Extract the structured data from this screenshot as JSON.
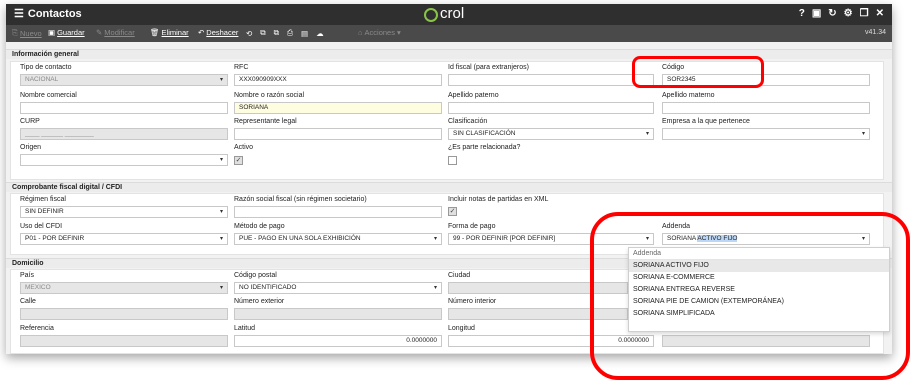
{
  "window": {
    "title": "Contactos",
    "brand": "crol",
    "version": "v41.34",
    "title_icons": [
      "help-icon",
      "chat-icon",
      "refresh-icon",
      "settings-icon",
      "restore-icon",
      "close-icon"
    ]
  },
  "toolbar": {
    "nuevo": "Nuevo",
    "guardar": "Guardar",
    "modificar": "Modificar",
    "eliminar": "Eliminar",
    "deshacer": "Deshacer",
    "acciones": "Acciones"
  },
  "general": {
    "section_title": "Información general",
    "tipo_contacto_label": "Tipo de contacto",
    "tipo_contacto_value": "NACIONAL",
    "rfc_label": "RFC",
    "rfc_value": "XXX090909XXX",
    "id_fiscal_label": "Id fiscal (para extranjeros)",
    "id_fiscal_value": "",
    "codigo_label": "Código",
    "codigo_value": "SOR2345",
    "nombre_comercial_label": "Nombre comercial",
    "nombre_comercial_value": "",
    "razon_social_label": "Nombre o razón social",
    "razon_social_value": "SORIANA",
    "apellido_paterno_label": "Apellido paterno",
    "apellido_paterno_value": "",
    "apellido_materno_label": "Apellido materno",
    "apellido_materno_value": "",
    "curp_label": "CURP",
    "curp_value": "____ ______ ________",
    "representante_label": "Representante legal",
    "representante_value": "",
    "clasificacion_label": "Clasificación",
    "clasificacion_value": "SIN CLASIFICACIÓN",
    "empresa_label": "Empresa a la que pertenece",
    "empresa_value": "",
    "origen_label": "Origen",
    "origen_value": "",
    "activo_label": "Activo",
    "parte_relacionada_label": "¿Es parte relacionada?"
  },
  "cfdi": {
    "section_title": "Comprobante fiscal digital / CFDI",
    "regimen_label": "Régimen fiscal",
    "regimen_value": "SIN DEFINIR",
    "razon_sin_regimen_label": "Razón social fiscal (sin régimen societario)",
    "razon_sin_regimen_value": "",
    "incluir_notas_label": "Incluir notas de partidas en XML",
    "uso_cfdi_label": "Uso del CFDI",
    "uso_cfdi_value": "P01 - POR DEFINIR",
    "metodo_pago_label": "Método de pago",
    "metodo_pago_value": "PUE - PAGO EN UNA SOLA EXHIBICIÓN",
    "forma_pago_label": "Forma de pago",
    "forma_pago_value": "99 - POR DEFINIR [POR DEFINIR]",
    "addenda_label": "Addenda",
    "addenda_prefix": "SORIANA",
    "addenda_highlight": "ACTIVO FIJO"
  },
  "domicilio": {
    "section_title": "Domicilio",
    "pais_label": "País",
    "pais_value": "MEXICO",
    "cp_label": "Código postal",
    "cp_value": "NO IDENTIFICADO",
    "ciudad_label": "Ciudad",
    "calle_label": "Calle",
    "num_ext_label": "Número exterior",
    "num_int_label": "Número interior",
    "referencia_label": "Referencia",
    "latitud_label": "Latitud",
    "latitud_value": "0.0000000",
    "longitud_label": "Longitud",
    "longitud_value": "0.0000000"
  },
  "addenda_dropdown": {
    "header": "Addenda",
    "options": [
      "SORIANA ACTIVO FIJO",
      "SORIANA E-COMMERCE",
      "SORIANA ENTREGA REVERSE",
      "SORIANA PIE DE CAMION (EXTEMPORÁNEA)",
      "SORIANA SIMPLIFICADA"
    ],
    "selected": "SORIANA ACTIVO FIJO"
  },
  "colors": {
    "titlebar": "#2f2f2f",
    "toolbar": "#4a4a4a",
    "annotation": "#ff0000",
    "brand_accent": "#8bc34a",
    "highlight": "#bcd7f5"
  }
}
